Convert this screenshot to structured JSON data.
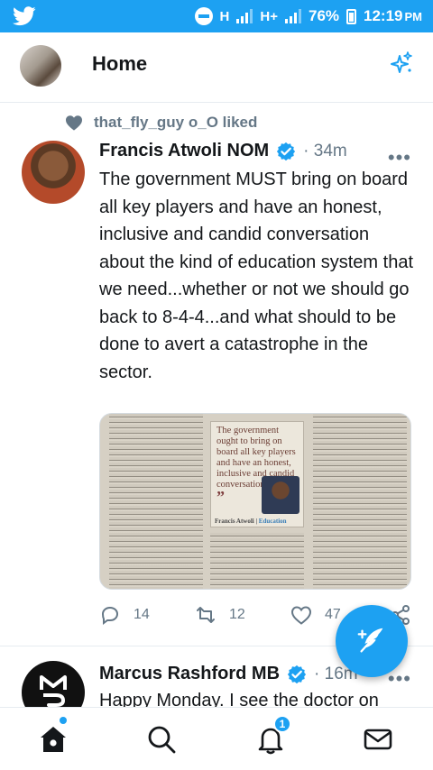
{
  "status_bar": {
    "network_1": "H",
    "network_2": "H+",
    "battery": "76%",
    "time": "12:19",
    "ampm": "PM"
  },
  "header": {
    "title": "Home"
  },
  "timeline": [
    {
      "social_context": "that_fly_guy o_O liked",
      "author_name": "Francis Atwoli NOM",
      "time": "· 34m",
      "text": "The government MUST bring on board all key players and have an honest, inclusive and candid conversation about the kind of education system that we need...whether or not we should go back to 8-4-4...and what should to be done to avert a catastrophe in the sector.",
      "media": {
        "pull_quote": "The government ought to bring on board all key players and have an honest, inclusive and candid conversation",
        "caption_name": "Francis Atwoli",
        "caption_section": "Education"
      },
      "replies": "14",
      "retweets": "12",
      "likes": "47"
    },
    {
      "author_name": "Marcus Rashford MB",
      "time": "· 16m",
      "text": "Happy Monday. I see the doctor on"
    }
  ],
  "colors": {
    "brand": "#1da1f2",
    "secondary_text": "#657786"
  },
  "bottom_nav": {
    "notifications_count": "1"
  }
}
